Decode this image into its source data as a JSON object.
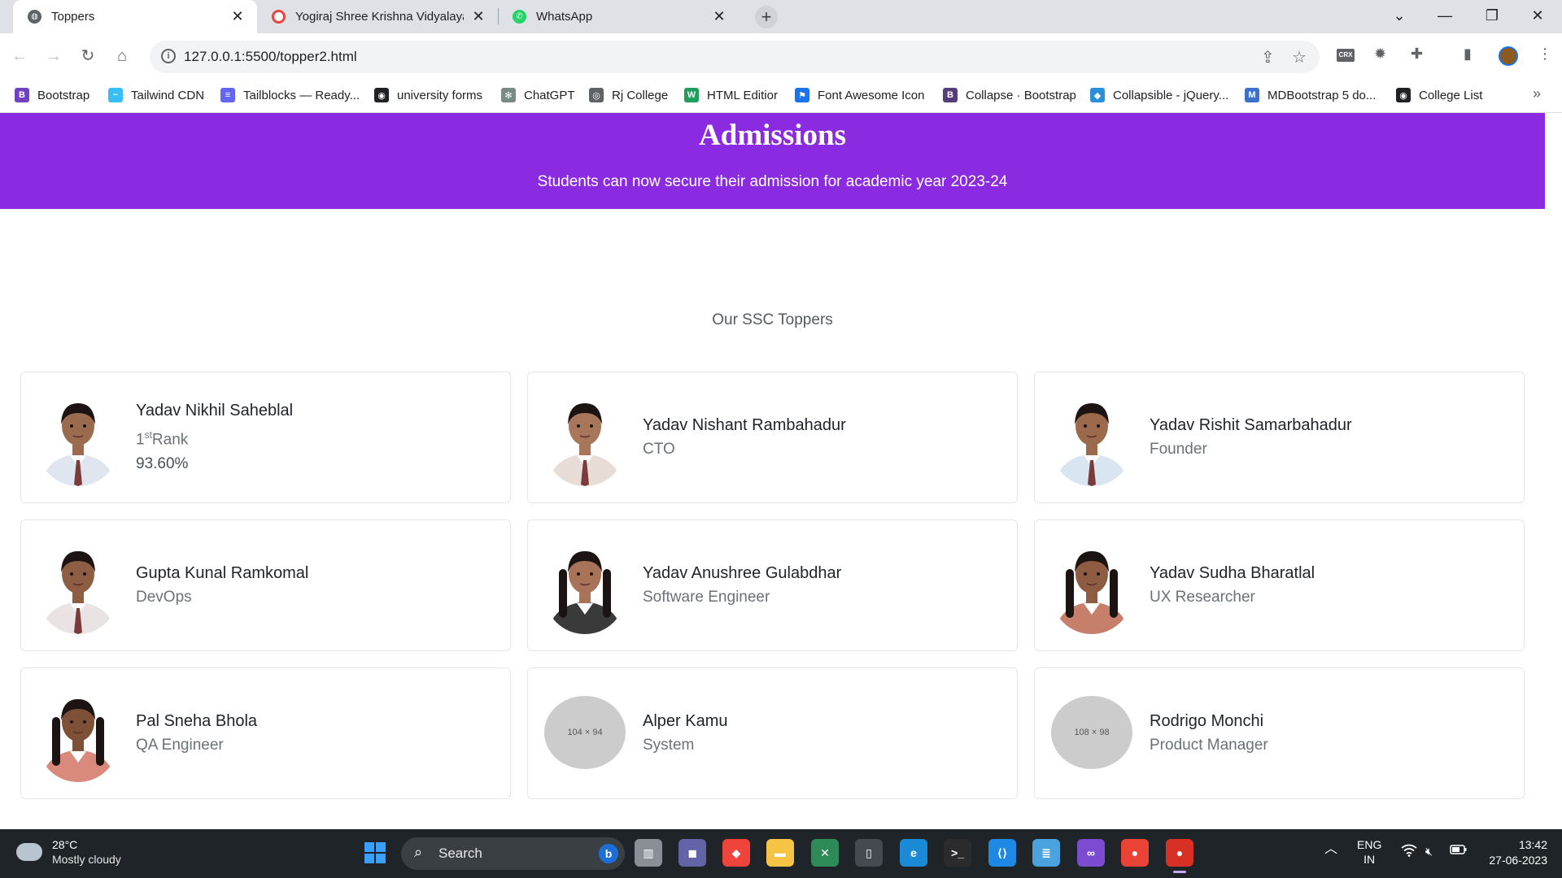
{
  "browser": {
    "tabs": [
      {
        "title": "Toppers",
        "active": true
      },
      {
        "title": "Yogiraj Shree Krishna Vidyalaya",
        "active": false
      },
      {
        "title": "WhatsApp",
        "active": false
      }
    ],
    "url": "127.0.0.1:5500/topper2.html",
    "crx_label": "CRX",
    "bookmarks": [
      {
        "label": "Bootstrap",
        "icon": "bootstrap-icon",
        "color": "#6f42c1",
        "glyph": "B"
      },
      {
        "label": "Tailwind CDN",
        "icon": "tailwind-icon",
        "color": "#38bdf8",
        "glyph": "~"
      },
      {
        "label": "Tailblocks — Ready...",
        "icon": "tailblocks-icon",
        "color": "#6366f1",
        "glyph": "≡"
      },
      {
        "label": "university forms",
        "icon": "university-forms-icon",
        "color": "#202124",
        "glyph": "◉"
      },
      {
        "label": "ChatGPT",
        "icon": "chatgpt-icon",
        "color": "#7a8a85",
        "glyph": "✻"
      },
      {
        "label": "Rj College",
        "icon": "rj-college-icon",
        "color": "#5f6368",
        "glyph": "◎"
      },
      {
        "label": "HTML Editior",
        "icon": "html-editor-icon",
        "color": "#1e9e5a",
        "glyph": "W"
      },
      {
        "label": "Font Awesome Icon",
        "icon": "font-awesome-icon",
        "color": "#1a73e8",
        "glyph": "⚑"
      },
      {
        "label": "Collapse · Bootstrap",
        "icon": "bootstrap-icon",
        "color": "#563d7c",
        "glyph": "B"
      },
      {
        "label": "Collapsible - jQuery...",
        "icon": "jquery-icon",
        "color": "#2b8fd6",
        "glyph": "◆"
      },
      {
        "label": "MDBootstrap 5 do...",
        "icon": "mdb-icon",
        "color": "#3b71ca",
        "glyph": "M"
      },
      {
        "label": "College List",
        "icon": "college-list-icon",
        "color": "#202124",
        "glyph": "◉"
      }
    ]
  },
  "banner": {
    "title": "Admissions",
    "subtitle": "Students can now secure their admission for academic year 2023-24"
  },
  "section": {
    "title": "Our SSC Toppers"
  },
  "toppers": [
    {
      "name": "Yadav Nikhil Saheblal",
      "rank_num": "1",
      "rank_sup": "st",
      "rank_word": "Rank",
      "percentage": "93.60%",
      "photo": "photo",
      "shirt": "#dfe6ef",
      "skin": "#9a6b4f"
    },
    {
      "name": "Yadav Nishant Rambahadur",
      "role": "CTO",
      "photo": "photo",
      "shirt": "#e8dcd6",
      "skin": "#a8765a"
    },
    {
      "name": "Yadav Rishit Samarbahadur",
      "role": "Founder",
      "photo": "photo",
      "shirt": "#d9e6f2",
      "skin": "#9b6a4c"
    },
    {
      "name": "Gupta Kunal Ramkomal",
      "role": "DevOps",
      "photo": "photo",
      "shirt": "#e9e3e3",
      "skin": "#8d5e43"
    },
    {
      "name": "Yadav Anushree Gulabdhar",
      "role": "Software Engineer",
      "photo": "photo",
      "shirt": "#3a3a3a",
      "skin": "#a87358"
    },
    {
      "name": "Yadav Sudha Bharatlal",
      "role": "UX Researcher",
      "photo": "photo",
      "shirt": "#c67f6a",
      "skin": "#8e5c42"
    },
    {
      "name": "Pal Sneha Bhola",
      "role": "QA Engineer",
      "photo": "photo",
      "shirt": "#d98a7d",
      "skin": "#7e5038"
    },
    {
      "name": "Alper Kamu",
      "role": "System",
      "photo": "placeholder",
      "placeholder_text": "104 × 94"
    },
    {
      "name": "Rodrigo Monchi",
      "role": "Product Manager",
      "photo": "placeholder",
      "placeholder_text": "108 × 98"
    }
  ],
  "taskbar": {
    "weather_temp": "28°C",
    "weather_desc": "Mostly cloudy",
    "search_label": "Search",
    "lang_line1": "ENG",
    "lang_line2": "IN",
    "time": "13:42",
    "date": "27-06-2023",
    "apps": [
      {
        "name": "file-manager-icon",
        "color": "#8a8f96",
        "glyph": "▥"
      },
      {
        "name": "teams-chat-icon",
        "color": "#6264a7",
        "glyph": "◼"
      },
      {
        "name": "anydesk-icon",
        "color": "#ef443b",
        "glyph": "◆"
      },
      {
        "name": "file-explorer-icon",
        "color": "#f6c445",
        "glyph": "▬"
      },
      {
        "name": "photo-app-icon",
        "color": "#2e8b57",
        "glyph": "✕"
      },
      {
        "name": "phone-link-icon",
        "color": "#444a50",
        "glyph": "▯"
      },
      {
        "name": "edge-icon",
        "color": "#1a8ad6",
        "glyph": "e"
      },
      {
        "name": "terminal-icon",
        "color": "#2b2b2b",
        "glyph": ">_"
      },
      {
        "name": "vscode-icon",
        "color": "#1e88e5",
        "glyph": "⟨⟩"
      },
      {
        "name": "notepad-icon",
        "color": "#4aa3df",
        "glyph": "≣"
      },
      {
        "name": "visual-studio-icon",
        "color": "#7b4bd1",
        "glyph": "∞"
      },
      {
        "name": "chrome-icon",
        "color": "#e94335",
        "glyph": "●"
      },
      {
        "name": "chrome-profile-icon",
        "color": "#d93025",
        "glyph": "●"
      }
    ]
  }
}
